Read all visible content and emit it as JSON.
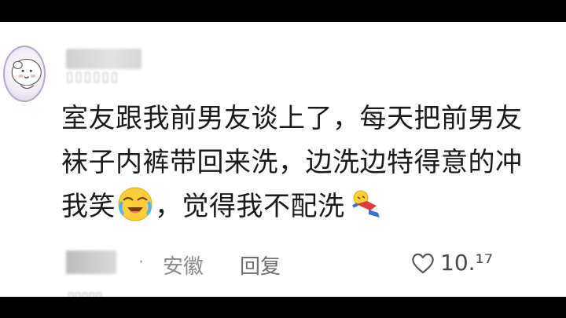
{
  "comment": {
    "username_hidden": "",
    "lines": [
      "室友跟我前男友谈上了，每天把前男友",
      "袜子内裤带回来洗，边洗边特得意的冲",
      "我笑",
      "，觉得我不配洗"
    ],
    "emojis": [
      "crying-laughing-emoji",
      "fallen-down-emoji"
    ]
  },
  "meta": {
    "separator": "·",
    "location": "安徽",
    "reply_label": "回复",
    "like_count": "10.¹⁷"
  },
  "colors": {
    "background": "#000000",
    "card": "#ffffff",
    "text": "#1a1a1a",
    "meta": "#8a8a8a"
  }
}
